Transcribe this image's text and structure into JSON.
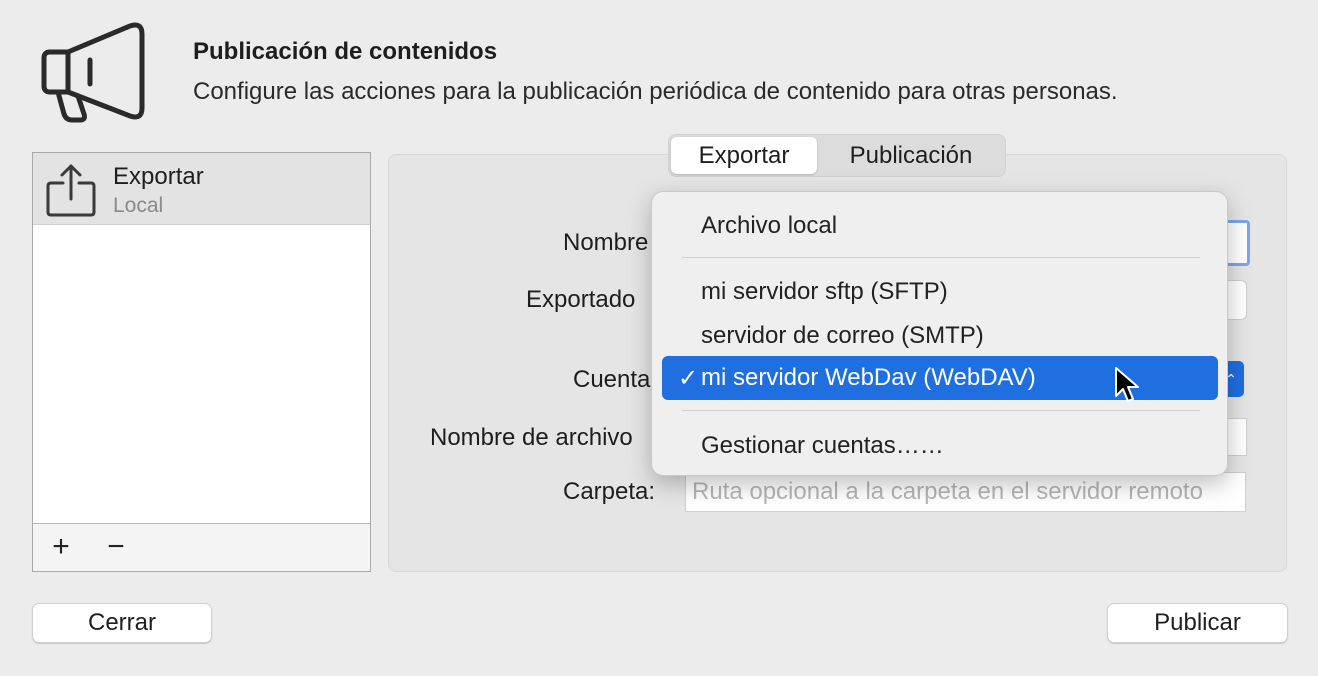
{
  "header": {
    "icon": "megaphone-icon",
    "title": "Publicación de contenidos",
    "subtitle": "Configure las acciones para la publicación periódica de contenido para otras personas."
  },
  "list": {
    "items": [
      {
        "icon": "share-upload-icon",
        "name": "Exportar",
        "sub": "Local"
      }
    ],
    "add_label": "+",
    "remove_label": "−"
  },
  "tabs": [
    {
      "label": "Exportar",
      "active": true
    },
    {
      "label": "Publicación",
      "active": false
    }
  ],
  "form": {
    "name_label": "Nombre",
    "exporter_label": "Exportado",
    "account_label": "Cuenta",
    "filename_label": "Nombre de archivo",
    "folder_label": "Carpeta:",
    "folder_placeholder": "Ruta opcional a la carpeta en el servidor remoto"
  },
  "menu": {
    "items": [
      {
        "label": "Archivo local"
      },
      {
        "label": "mi servidor sftp (SFTP)"
      },
      {
        "label": "servidor de correo (SMTP)"
      },
      {
        "label": "mi servidor WebDav (WebDAV)",
        "selected": true
      },
      {
        "label": "Gestionar cuentas……"
      }
    ],
    "checkmark": "✓"
  },
  "buttons": {
    "close": "Cerrar",
    "publish": "Publicar"
  },
  "colors": {
    "accent": "#1f6fe0",
    "background": "#ececec"
  }
}
